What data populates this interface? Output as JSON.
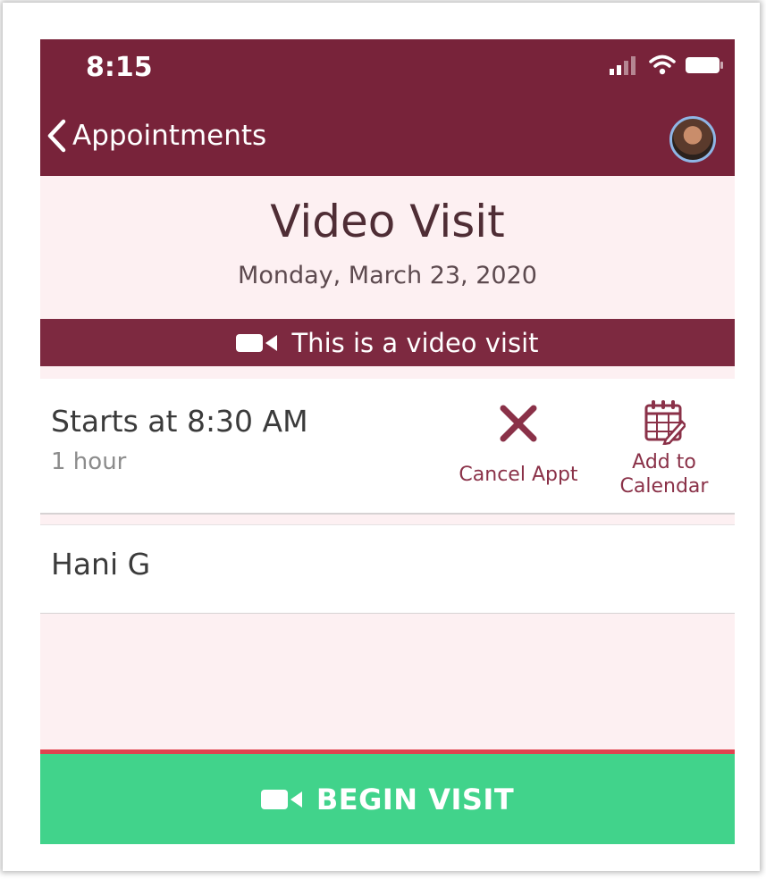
{
  "status_bar": {
    "time": "8:15"
  },
  "nav": {
    "back_label": "Appointments"
  },
  "appointment": {
    "title": "Video Visit",
    "date": "Monday, March 23, 2020",
    "banner_text": "This is a video visit",
    "start": "Starts at 8:30 AM",
    "duration": "1 hour",
    "provider": "Hani G"
  },
  "actions": {
    "cancel_label": "Cancel Appt",
    "calendar_label_line1": "Add to",
    "calendar_label_line2": "Calendar"
  },
  "begin": {
    "label": "BEGIN VISIT"
  },
  "icons": {
    "back": "chevron-left-icon",
    "signal": "cellular-signal-icon",
    "wifi": "wifi-icon",
    "battery": "battery-icon",
    "video": "video-camera-icon",
    "cancel": "close-icon",
    "calendar": "calendar-icon"
  },
  "colors": {
    "brand": "#78233a",
    "banner": "#7d2940",
    "background": "#fdf0f2",
    "accent_text": "#8a3148",
    "begin_button": "#41d38b",
    "separator_red": "#e0434f"
  }
}
